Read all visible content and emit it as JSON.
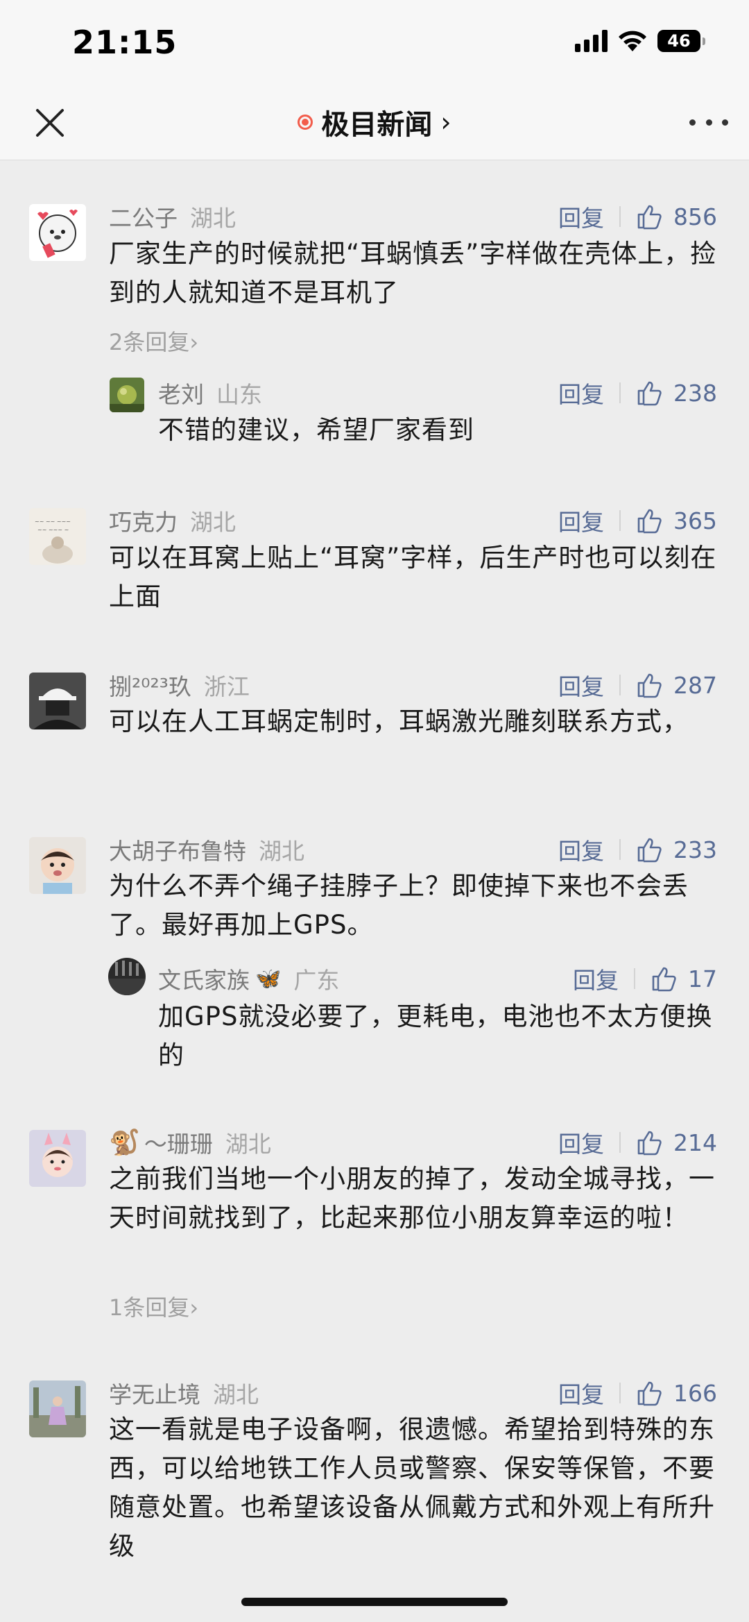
{
  "status": {
    "time": "21:15",
    "battery": "46"
  },
  "nav": {
    "title": "极目新闻",
    "chevron": "›"
  },
  "labels": {
    "reply": "回复"
  },
  "comments": [
    {
      "user": "二公子",
      "region": "湖北",
      "likes": "856",
      "text": "厂家生产的时候就把“耳蜗慎丢”字样做在壳体上，捡到的人就知道不是耳机了",
      "more_replies": "2条回复›",
      "reply": {
        "user": "老刘",
        "region": "山东",
        "likes": "238",
        "text": "不错的建议，希望厂家看到"
      }
    },
    {
      "user": "巧克力",
      "region": "湖北",
      "likes": "365",
      "text": "可以在耳窝上贴上“耳窝”字样，后生产时也可以刻在上面"
    },
    {
      "user": "捌²⁰²³玖",
      "region": "浙江",
      "likes": "287",
      "text": "可以在人工耳蜗定制时，耳蜗激光雕刻联系方式，"
    },
    {
      "user": "大胡子布鲁特",
      "region": "湖北",
      "likes": "233",
      "text": "为什么不弄个绳子挂脖子上？即使掉下来也不会丢了。最好再加上GPS。",
      "reply": {
        "user": "文氏家族",
        "badge": "🦋",
        "region": "广东",
        "likes": "17",
        "text": "加GPS就没必要了，更耗电，电池也不太方便换的"
      }
    },
    {
      "user": "～珊珊",
      "emoji": "🐒",
      "region": "湖北",
      "likes": "214",
      "text": "之前我们当地一个小朋友的掉了，发动全城寻找，一天时间就找到了，比起来那位小朋友算幸运的啦！",
      "more_replies": "1条回复›"
    },
    {
      "user": "学无止境",
      "region": "湖北",
      "likes": "166",
      "text": "这一看就是电子设备啊，很遗憾。希望拾到特殊的东西，可以给地铁工作人员或警察、保安等保管，不要随意处置。也希望该设备从佩戴方式和外观上有所升级"
    }
  ]
}
